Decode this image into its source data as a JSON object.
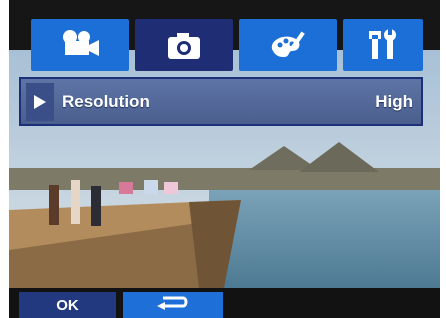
{
  "tabs": [
    {
      "icon": "video-camera-icon",
      "selected": false
    },
    {
      "icon": "camera-icon",
      "selected": true
    },
    {
      "icon": "palette-icon",
      "selected": false
    },
    {
      "icon": "tools-icon",
      "selected": false
    }
  ],
  "menu": {
    "label": "Resolution",
    "value": "High"
  },
  "footer": {
    "ok_label": "OK",
    "back_icon": "return-arrow-icon"
  },
  "colors": {
    "tab_blue": "#1b6fd6",
    "tab_selected_bg": "#1f2d74",
    "menu_row": "#4f6599",
    "ok_button": "#23397f",
    "back_button": "#1f6fd8"
  }
}
